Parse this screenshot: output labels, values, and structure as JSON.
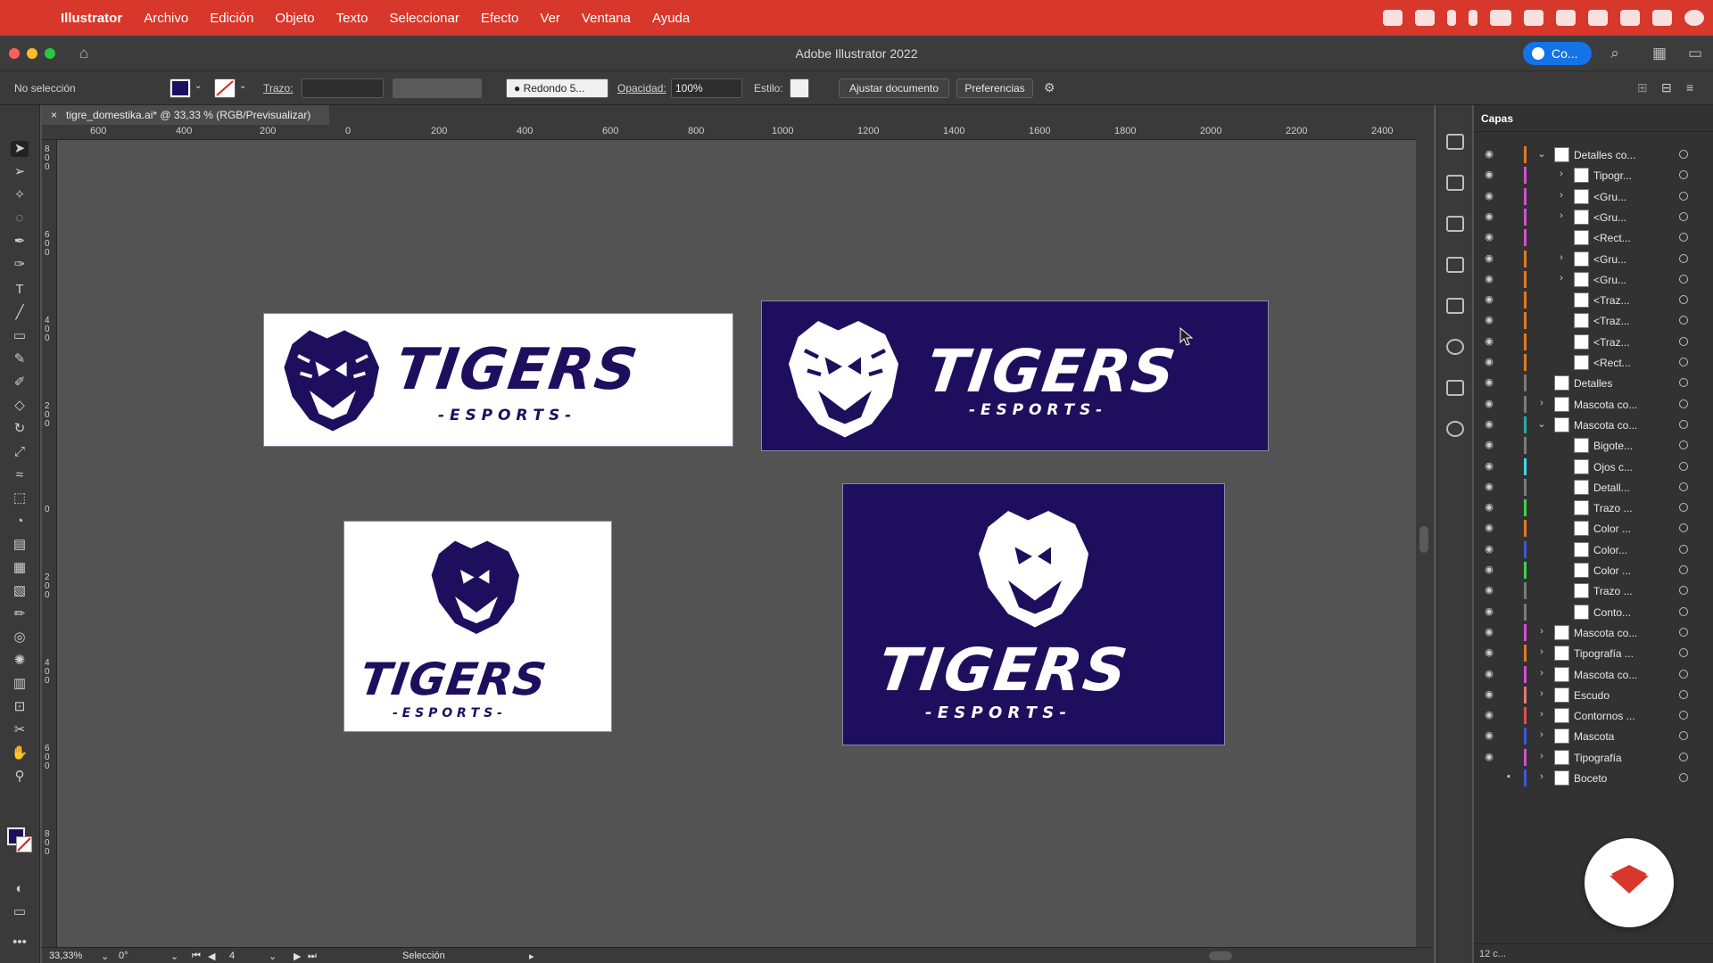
{
  "menubar": {
    "app_name": "Illustrator",
    "items": [
      "Archivo",
      "Edición",
      "Objeto",
      "Texto",
      "Seleccionar",
      "Efecto",
      "Ver",
      "Ventana",
      "Ayuda"
    ]
  },
  "titlebar": {
    "title": "Adobe Illustrator 2022",
    "cloud_button": "Co..."
  },
  "control_bar": {
    "selection_status": "No selección",
    "fill_color": "#1e0f5e",
    "stroke_label": "Trazo:",
    "brush_label": "Redondo 5...",
    "opacity_label": "Opacidad:",
    "opacity_value": "100%",
    "style_label": "Estilo:",
    "adjust_button": "Ajustar documento",
    "prefs_button": "Preferencias"
  },
  "document_tab": {
    "title": "tigre_domestika.ai* @ 33,33 % (RGB/Previsualizar)"
  },
  "rulers": {
    "horizontal": [
      "600",
      "400",
      "200",
      "0",
      "200",
      "400",
      "600",
      "800",
      "1000",
      "1200",
      "1400",
      "1600",
      "1800",
      "2000",
      "2200",
      "2400"
    ],
    "vertical": [
      "800",
      "600",
      "400",
      "200",
      "0",
      "200",
      "400",
      "600",
      "800"
    ]
  },
  "artwork": {
    "brand_text": "TIGERS",
    "sub_text": "- E S P O R T S -",
    "navy": "#1e0f5e",
    "white": "#ffffff"
  },
  "layers_panel": {
    "title": "Capas",
    "rows": [
      {
        "name": "Detalles co...",
        "color": "#e07a20",
        "chev": "open",
        "indent": 0
      },
      {
        "name": "Tipogr...",
        "color": "#d24fd2",
        "chev": "closed",
        "indent": 1
      },
      {
        "name": "<Gru...",
        "color": "#d24fd2",
        "chev": "closed",
        "indent": 1
      },
      {
        "name": "<Gru...",
        "color": "#d24fd2",
        "chev": "closed",
        "indent": 1
      },
      {
        "name": "<Rect...",
        "color": "#d24fd2",
        "chev": "none",
        "indent": 1
      },
      {
        "name": "<Gru...",
        "color": "#e07a20",
        "chev": "closed",
        "indent": 1
      },
      {
        "name": "<Gru...",
        "color": "#e07a20",
        "chev": "closed",
        "indent": 1
      },
      {
        "name": "<Traz...",
        "color": "#e07a20",
        "chev": "none",
        "indent": 1
      },
      {
        "name": "<Traz...",
        "color": "#e07a20",
        "chev": "none",
        "indent": 1
      },
      {
        "name": "<Traz...",
        "color": "#e07a20",
        "chev": "none",
        "indent": 1
      },
      {
        "name": "<Rect...",
        "color": "#e07a20",
        "chev": "none",
        "indent": 1
      },
      {
        "name": "Detalles",
        "color": "#7a7a7a",
        "chev": "none",
        "indent": 0
      },
      {
        "name": "Mascota co...",
        "color": "#7a7a7a",
        "chev": "closed",
        "indent": 0
      },
      {
        "name": "Mascota co...",
        "color": "#2aa8a8",
        "chev": "open",
        "indent": 0
      },
      {
        "name": "Bigote...",
        "color": "#7a7a7a",
        "chev": "none",
        "indent": 1
      },
      {
        "name": "Ojos c...",
        "color": "#3fd6e8",
        "chev": "none",
        "indent": 1
      },
      {
        "name": "Detall...",
        "color": "#7a7a7a",
        "chev": "none",
        "indent": 1
      },
      {
        "name": "Trazo ...",
        "color": "#3fd04f",
        "chev": "none",
        "indent": 1
      },
      {
        "name": "Color ...",
        "color": "#e07a20",
        "chev": "none",
        "indent": 1
      },
      {
        "name": "Color...",
        "color": "#3a5ad8",
        "chev": "none",
        "indent": 1
      },
      {
        "name": "Color ...",
        "color": "#3fd04f",
        "chev": "none",
        "indent": 1
      },
      {
        "name": "Trazo ...",
        "color": "#7a7a7a",
        "chev": "none",
        "indent": 1
      },
      {
        "name": "Conto...",
        "color": "#7a7a7a",
        "chev": "none",
        "indent": 1
      },
      {
        "name": "Mascota co...",
        "color": "#d24fd2",
        "chev": "closed",
        "indent": 0
      },
      {
        "name": "Tipografía ...",
        "color": "#e07a20",
        "chev": "closed",
        "indent": 0
      },
      {
        "name": "Mascota co...",
        "color": "#d24fd2",
        "chev": "closed",
        "indent": 0
      },
      {
        "name": "Escudo",
        "color": "#e07a70",
        "chev": "closed",
        "indent": 0
      },
      {
        "name": "Contornos ...",
        "color": "#e05050",
        "chev": "closed",
        "indent": 0
      },
      {
        "name": "Mascota",
        "color": "#3a5ad8",
        "chev": "closed",
        "indent": 0
      },
      {
        "name": "Tipografía",
        "color": "#d24fd2",
        "chev": "closed",
        "indent": 0
      },
      {
        "name": "Boceto",
        "color": "#3a5ad8",
        "chev": "closed",
        "indent": 0,
        "locked": true
      }
    ],
    "footer": "12 c..."
  },
  "status_bar": {
    "zoom": "33,33%",
    "rotation": "0°",
    "artboard": "4",
    "tool": "Selección"
  }
}
